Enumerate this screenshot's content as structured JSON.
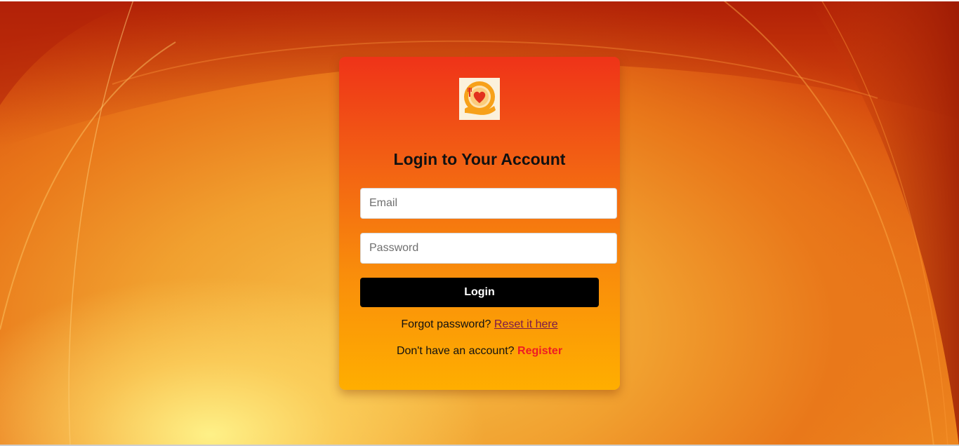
{
  "login": {
    "title": "Login to Your Account",
    "email_placeholder": "Email",
    "password_placeholder": "Password",
    "login_label": "Login",
    "forgot_text": "Forgot password?",
    "reset_link": "Reset it here",
    "no_account_text": "Don't have an account?",
    "register_link": "Register"
  },
  "colors": {
    "card_top": "#ef3318",
    "card_bottom": "#ffae00",
    "button": "#000000",
    "register_link": "#ee1c24",
    "reset_link": "#7b1a4a"
  },
  "icons": {
    "logo": "heart-plate-hand-icon"
  }
}
